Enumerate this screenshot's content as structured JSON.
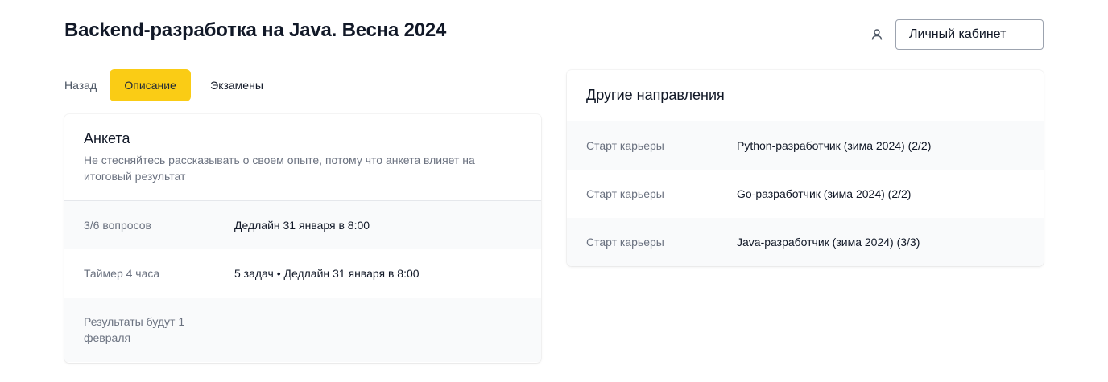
{
  "header": {
    "title": "Backend-разработка на Java. Весна 2024",
    "cabinet_label": "Личный кабинет",
    "user_icon": "user-icon"
  },
  "tabs": {
    "back": "Назад",
    "description": "Описание",
    "exams": "Экзамены"
  },
  "questionnaire": {
    "title": "Анкета",
    "subtitle": "Не стесняйтесь рассказывать о своем опыте, потому что анкета влияет на итоговый результат",
    "rows": [
      {
        "label": "3/6 вопросов",
        "value": "Дедлайн 31 января в 8:00"
      },
      {
        "label": "Таймер 4 часа",
        "value": "5 задач • Дедлайн 31 января в 8:00"
      },
      {
        "label": "Результаты будут 1 февраля",
        "value": ""
      }
    ]
  },
  "other_directions": {
    "title": "Другие направления",
    "rows": [
      {
        "label": "Старт карьеры",
        "value": "Python-разработчик (зима 2024) (2/2)"
      },
      {
        "label": "Старт карьеры",
        "value": "Go-разработчик (зима 2024) (2/2)"
      },
      {
        "label": "Старт карьеры",
        "value": "Java-разработчик (зима 2024) (3/3)"
      }
    ]
  },
  "colors": {
    "accent": "#facc15",
    "muted_text": "#6b7280",
    "row_alt_bg": "#f9fafb"
  }
}
